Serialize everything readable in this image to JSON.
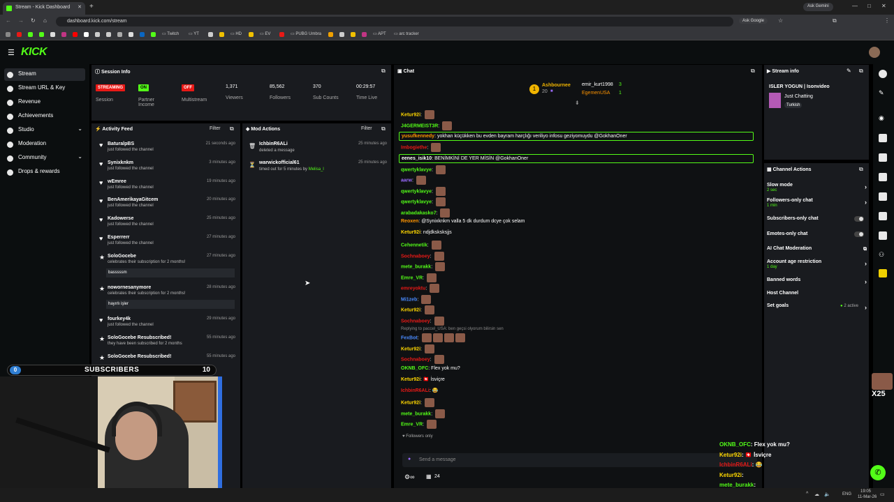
{
  "browser": {
    "tab_title": "Stream - Kick Dashboard",
    "url": "dashboard.kick.com/stream",
    "ask_google": "Ask Google",
    "ask_gemini": "Ask Gemini",
    "bookmarks": [
      "Twitch",
      "YT",
      "HD",
      "EV",
      "PUBG Umbra",
      "APT",
      "arc tracker"
    ]
  },
  "sidebar": {
    "items": [
      {
        "label": "Stream",
        "icon": "stream-icon"
      },
      {
        "label": "Stream URL & Key",
        "icon": "key-icon"
      },
      {
        "label": "Revenue",
        "icon": "revenue-icon"
      },
      {
        "label": "Achievements",
        "icon": "achievements-icon"
      },
      {
        "label": "Studio",
        "icon": "studio-icon"
      },
      {
        "label": "Moderation",
        "icon": "moderation-icon"
      },
      {
        "label": "Community",
        "icon": "community-icon"
      },
      {
        "label": "Drops & rewards",
        "icon": "drops-icon"
      }
    ]
  },
  "session": {
    "title": "Session Info",
    "stats": [
      {
        "label": "Session",
        "badge": "STREAMING",
        "color": "#e91916"
      },
      {
        "label": "Partner Income",
        "badge": "ON",
        "color": "#53fc18"
      },
      {
        "label": "Multistream",
        "badge": "OFF",
        "color": "#e91916"
      },
      {
        "label": "Viewers",
        "value": "1,371"
      },
      {
        "label": "Followers",
        "value": "85,562"
      },
      {
        "label": "Sub Counts",
        "value": "370"
      },
      {
        "label": "Time Live",
        "value": "00:29:57"
      }
    ]
  },
  "activity": {
    "title": "Activity Feed",
    "filter": "Filter",
    "items": [
      {
        "name": "BaturalpBS",
        "sub": "just followed the channel",
        "time": "21 seconds ago"
      },
      {
        "name": "Synixknkm",
        "sub": "just followed the channel",
        "time": "3 minutes ago"
      },
      {
        "name": "wEmree",
        "sub": "just followed the channel",
        "time": "19 minutes ago"
      },
      {
        "name": "BenAmerikayaGitcem",
        "sub": "just followed the channel",
        "time": "20 minutes ago"
      },
      {
        "name": "Kadowerse",
        "sub": "just followed the channel",
        "time": "25 minutes ago"
      },
      {
        "name": "Esperrerr",
        "sub": "just followed the channel",
        "time": "27 minutes ago"
      },
      {
        "name": "SoloGocebe",
        "sub": "celebrates their subscription for 2 months!",
        "time": "27 minutes ago",
        "msg": "basssssm"
      },
      {
        "name": "nowornesanymore",
        "sub": "celebrates their subscription for 2 months!",
        "time": "28 minutes ago",
        "msg": "hayırlı işler"
      },
      {
        "name": "fourkey4k",
        "sub": "just followed the channel",
        "time": "29 minutes ago"
      },
      {
        "name": "SoloGocebe Resubscribed!",
        "sub": "they have been subscribed for 2 months",
        "time": "55 minutes ago"
      },
      {
        "name": "SoloGocebe Resubscribed!",
        "sub": "",
        "time": "55 minutes ago"
      }
    ]
  },
  "mod": {
    "title": "Mod Actions",
    "filter": "Filter",
    "items": [
      {
        "name": "IchbinR6ALi",
        "sub": "deleted a message",
        "time": "25 minutes ago"
      },
      {
        "name": "warwickofficial61",
        "sub": "timed out for 5 minutes by",
        "by": "Melisa_l",
        "time": "25 minutes ago"
      }
    ]
  },
  "chat": {
    "title": "Chat",
    "top_gifters": [
      {
        "name": "Ashbournee",
        "count": "20"
      },
      {
        "name": "emir_kurt1998",
        "count": "3"
      },
      {
        "name": "EgemenUSA",
        "count": "1"
      }
    ],
    "lines": [
      {
        "user": "Ketur92i",
        "color": "#ffd700",
        "text": "",
        "emote": 1
      },
      {
        "user": "J4GERMEIST3R",
        "color": "#53fc18",
        "text": "",
        "emote": 1
      },
      {
        "user": "yusufkennedy",
        "color": "#ff9500",
        "text": "yokhan küçükken bu evden bayram harçlığı veriliyo infosu geziyomuydu @GokhanOner",
        "emote": 0,
        "hl": true
      },
      {
        "user": "Imbogiethe",
        "color": "#e91916",
        "text": "",
        "emote": 1
      },
      {
        "user": "eenes_isik10",
        "color": "#fff",
        "text": "BENİMKİNİ DE YER MİSİN @GokhanOner",
        "emote": 0,
        "hl": true
      },
      {
        "user": "qwertyklavye",
        "color": "#53fc18",
        "text": "",
        "emote": 1
      },
      {
        "user": "aarw",
        "color": "#9b6bff",
        "text": "",
        "emote": 1
      },
      {
        "user": "qwertyklavye",
        "color": "#53fc18",
        "text": "",
        "emote": 1
      },
      {
        "user": "qwertyklavye",
        "color": "#53fc18",
        "text": "",
        "emote": 1
      },
      {
        "user": "arabadakasko7",
        "color": "#53fc18",
        "text": "",
        "emote": 1
      },
      {
        "user": "Reoxen",
        "color": "#ff9500",
        "text": "@Synixknkm valla 5 dk durdum dcye çok selam",
        "emote": 0
      },
      {
        "user": "Ketur92i",
        "color": "#ffd700",
        "text": "ndjdksksksjjs",
        "emote": 0
      },
      {
        "user": "Cehennetik",
        "color": "#53fc18",
        "text": "",
        "emote": 1
      },
      {
        "user": "Sochnaboey",
        "color": "#e91916",
        "text": "",
        "emote": 1
      },
      {
        "user": "mete_burakk",
        "color": "#53fc18",
        "text": "",
        "emote": 1
      },
      {
        "user": "Emre_VR",
        "color": "#53fc18",
        "text": "",
        "emote": 1
      },
      {
        "user": "emreyoktu",
        "color": "#e91916",
        "text": "",
        "emote": 1
      },
      {
        "user": "Mi1zeb",
        "color": "#4a8bff",
        "text": "",
        "emote": 1
      },
      {
        "user": "Ketur92i",
        "color": "#ffd700",
        "text": "",
        "emote": 1
      },
      {
        "user": "Sochnaboey",
        "color": "#e91916",
        "text": "",
        "emote": 1
      },
      {
        "user": "FexBot",
        "color": "#4a8bff",
        "text": "",
        "emote": 4,
        "reply": "Replying to paccel_USA: ben geçsi olyorum bilirsin sen"
      },
      {
        "user": "Ketur92i",
        "color": "#ffd700",
        "text": "",
        "emote": 1
      },
      {
        "user": "Sochnaboey",
        "color": "#e91916",
        "text": "",
        "emote": 1
      },
      {
        "user": "OKNB_OFC",
        "color": "#53fc18",
        "text": "Flex yok mu?",
        "emote": 0
      },
      {
        "user": "Ketur92i",
        "color": "#ffd700",
        "text": "🇨🇭 İsviçre",
        "emote": 0
      },
      {
        "user": "IchbinR6ALi",
        "color": "#e91916",
        "text": "😂",
        "emote": 0
      },
      {
        "user": "Ketur92i",
        "color": "#ffd700",
        "text": "",
        "emote": 1
      },
      {
        "user": "mete_burakk",
        "color": "#53fc18",
        "text": "",
        "emote": 1
      },
      {
        "user": "Emre_VR",
        "color": "#53fc18",
        "text": "",
        "emote": 1
      }
    ],
    "followers_only": "Followers only",
    "placeholder": "Send a message",
    "count": "24"
  },
  "stream_info": {
    "title": "Stream info",
    "stream_title": "ISLER YOGUN | Isonvideo",
    "category": "Just Chatting",
    "tag": "Turkish"
  },
  "channel_actions": {
    "title": "Channel Actions",
    "items": [
      {
        "label": "Slow mode",
        "sub": "2 sec",
        "type": "chev"
      },
      {
        "label": "Followers-only chat",
        "sub": "1 min",
        "type": "chev"
      },
      {
        "label": "Subscribers-only chat",
        "sub": "",
        "type": "toggle"
      },
      {
        "label": "Emotes-only chat",
        "sub": "",
        "type": "toggle"
      },
      {
        "label": "AI Chat Moderation",
        "sub": "",
        "type": "ext"
      },
      {
        "label": "Account age restriction",
        "sub": "1 day",
        "type": "chev"
      },
      {
        "label": "Banned words",
        "sub": "",
        "type": "chev"
      },
      {
        "label": "Host Channel",
        "sub": "",
        "type": "none"
      },
      {
        "label": "Set goals",
        "sub": "",
        "type": "goals",
        "extra": "2 active"
      }
    ]
  },
  "overlay": {
    "sub_label": "SUBSCRIBERS",
    "sub_current": "0",
    "sub_goal": "10",
    "chat": [
      {
        "user": "OKNB_OFC",
        "text": "Flex yok mu?",
        "color": "#53fc18"
      },
      {
        "user": "Ketur92i",
        "text": "🇨🇭 İsviçre",
        "color": "#ffd700"
      },
      {
        "user": "IchbinR6ALi",
        "text": "😂",
        "color": "#e91916"
      },
      {
        "user": "Ketur92i",
        "text": "",
        "color": "#ffd700"
      },
      {
        "user": "mete_burakk",
        "text": "",
        "color": "#53fc18"
      },
      {
        "user": "Emre_VR",
        "text": "",
        "color": "#53fc18"
      }
    ],
    "multiplier": "X25"
  },
  "taskbar": {
    "lang": "ENG",
    "time": "19:05",
    "date": "11-Mar-26"
  }
}
